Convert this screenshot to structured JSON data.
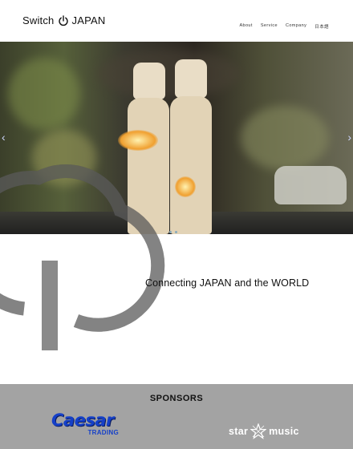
{
  "brand": {
    "name_left": "Switch",
    "name_right": "JAPAN"
  },
  "nav": {
    "items": [
      "About",
      "Service",
      "Company",
      "日本語"
    ]
  },
  "hero": {
    "image": "photo of glowing lamp figures",
    "arrows": [
      "‹",
      "›"
    ]
  },
  "tagline": "Connecting JAPAN and the WORLD",
  "sponsors": {
    "heading": "SPONSORS",
    "caesar": {
      "name": "Caesar",
      "sub": "TRADING"
    },
    "starmusic": {
      "left": "star",
      "right": "music"
    }
  }
}
